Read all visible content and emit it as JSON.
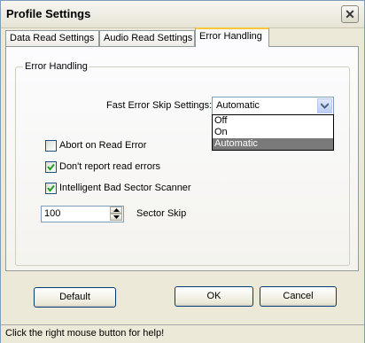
{
  "window": {
    "title": "Profile Settings",
    "close_symbol": "✕"
  },
  "tabs": [
    {
      "label": "Data Read Settings",
      "active": false
    },
    {
      "label": "Audio Read Settings",
      "active": false
    },
    {
      "label": "Error Handling",
      "active": true
    }
  ],
  "group": {
    "label": "Error Handling"
  },
  "fast_error_skip": {
    "label": "Fast Error Skip Settings:",
    "value": "Automatic",
    "options": [
      "Off",
      "On",
      "Automatic"
    ],
    "highlighted": "Automatic"
  },
  "checkboxes": [
    {
      "label": "Abort on Read Error",
      "checked": false
    },
    {
      "label": "Don't report read errors",
      "checked": true
    },
    {
      "label": "Intelligent Bad Sector Scanner",
      "checked": true
    }
  ],
  "sector_skip": {
    "value": "100",
    "label": "Sector Skip"
  },
  "buttons": {
    "default": "Default",
    "ok": "OK",
    "cancel": "Cancel"
  },
  "status": {
    "text": "Click the right mouse button for help!"
  }
}
